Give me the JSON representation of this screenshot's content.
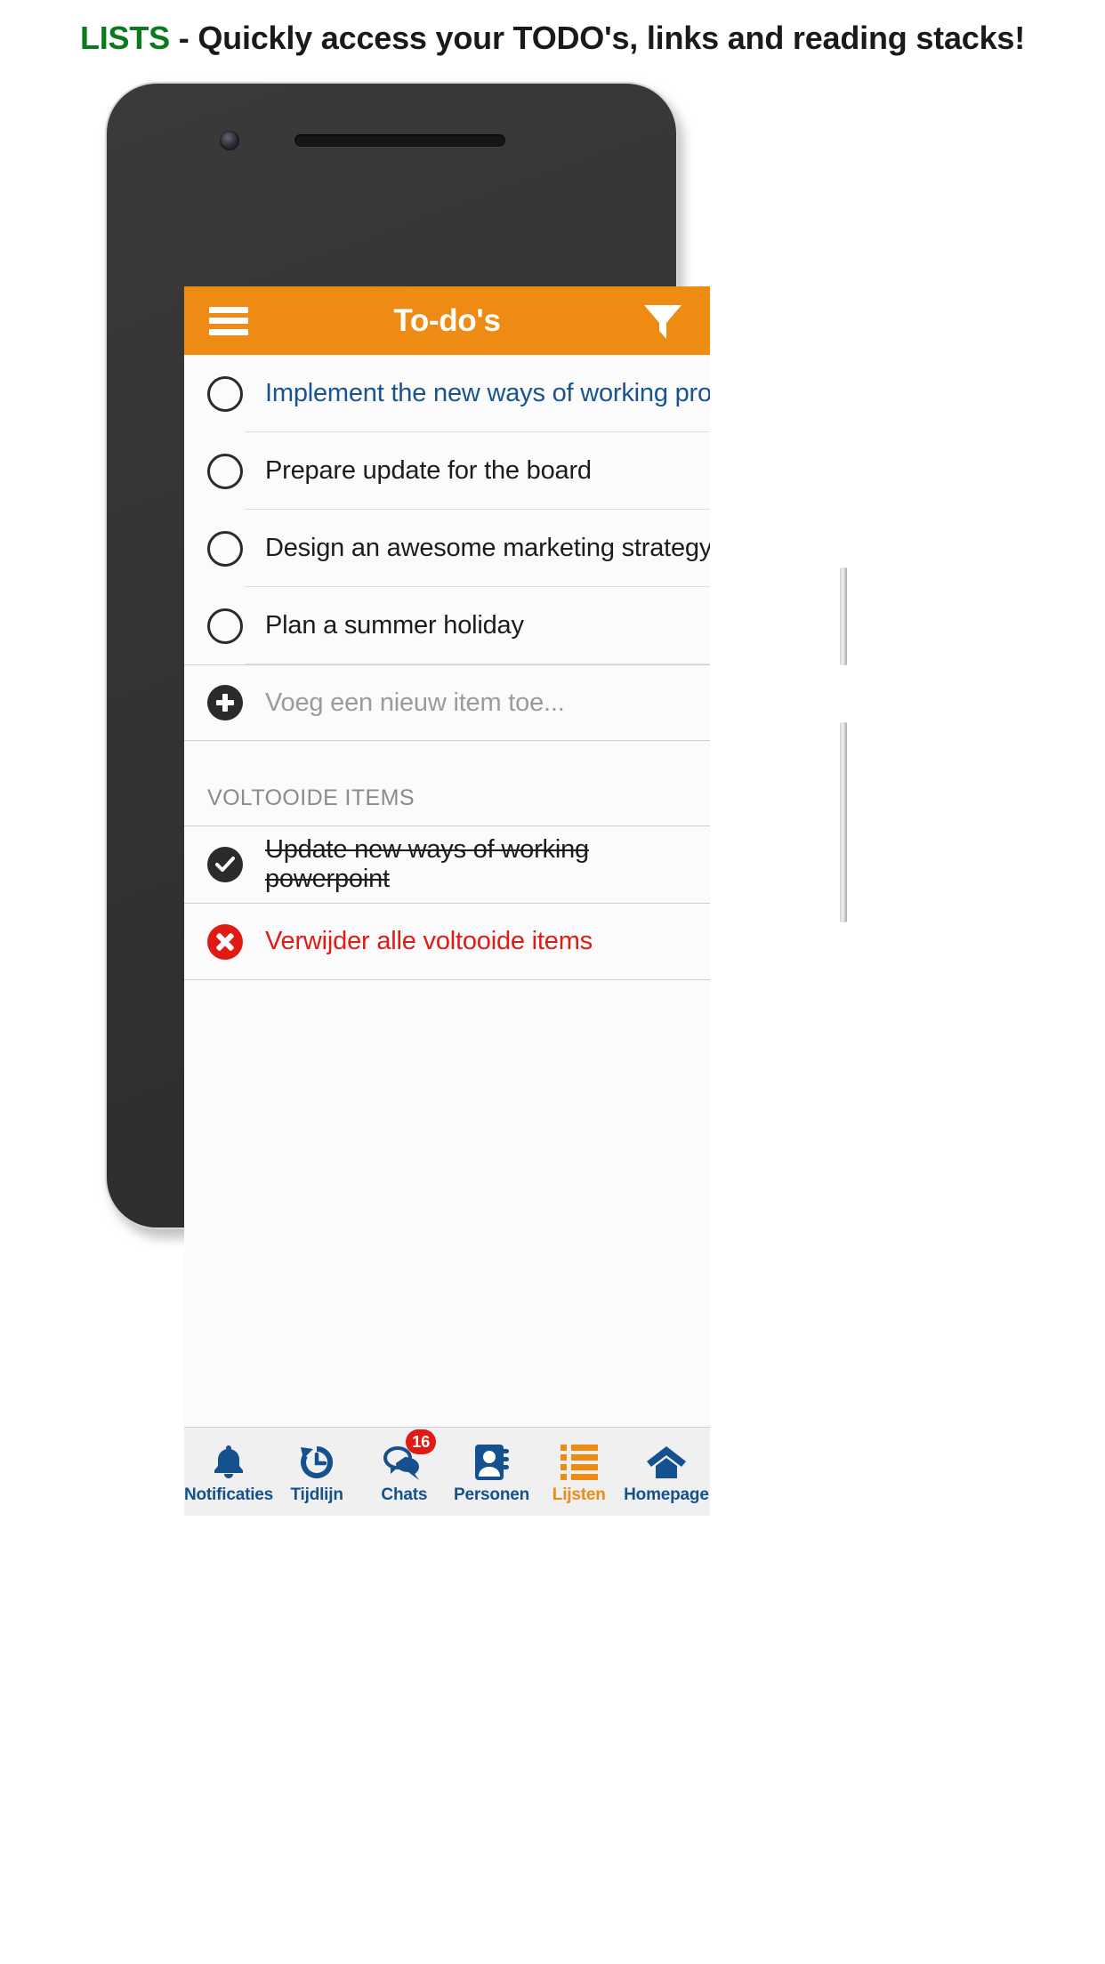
{
  "caption": {
    "highlight": "LISTS",
    "rest": " - Quickly access your TODO's, links and reading stacks!"
  },
  "colors": {
    "accent_orange": "#ED8B13",
    "link_blue": "#1A5490",
    "nav_blue": "#15508f",
    "danger_red": "#e01b14",
    "caption_green": "#0a7a1e",
    "screen_bg": "#fbfbfb"
  },
  "appbar": {
    "menu_icon": "hamburger-icon",
    "title": "To-do's",
    "filter_icon": "filter-funnel-icon"
  },
  "todos": [
    {
      "label": "Implement the new ways of working program",
      "style": "link"
    },
    {
      "label": "Prepare update for the board",
      "style": "normal"
    },
    {
      "label": "Design an awesome marketing strategy",
      "style": "normal"
    },
    {
      "label": "Plan a summer holiday",
      "style": "normal"
    }
  ],
  "add_row": {
    "icon": "plus-circle-icon",
    "placeholder": "Voeg een nieuw item toe..."
  },
  "completed_section": {
    "header": "VOLTOOIDE ITEMS",
    "items": [
      {
        "label": "Update new ways of working powerpoint",
        "icon": "check-circle-icon"
      }
    ],
    "delete_all": {
      "label": "Verwijder alle voltooide items",
      "icon": "x-circle-icon"
    }
  },
  "bottom_nav": [
    {
      "label": "Notificaties",
      "icon": "bell-icon",
      "active": false,
      "badge": ""
    },
    {
      "label": "Tijdlijn",
      "icon": "history-icon",
      "active": false,
      "badge": ""
    },
    {
      "label": "Chats",
      "icon": "chat-icon",
      "active": false,
      "badge": "16"
    },
    {
      "label": "Personen",
      "icon": "contacts-icon",
      "active": false,
      "badge": ""
    },
    {
      "label": "Lijsten",
      "icon": "list-icon",
      "active": true,
      "badge": ""
    },
    {
      "label": "Homepage",
      "icon": "home-icon",
      "active": false,
      "badge": ""
    }
  ]
}
